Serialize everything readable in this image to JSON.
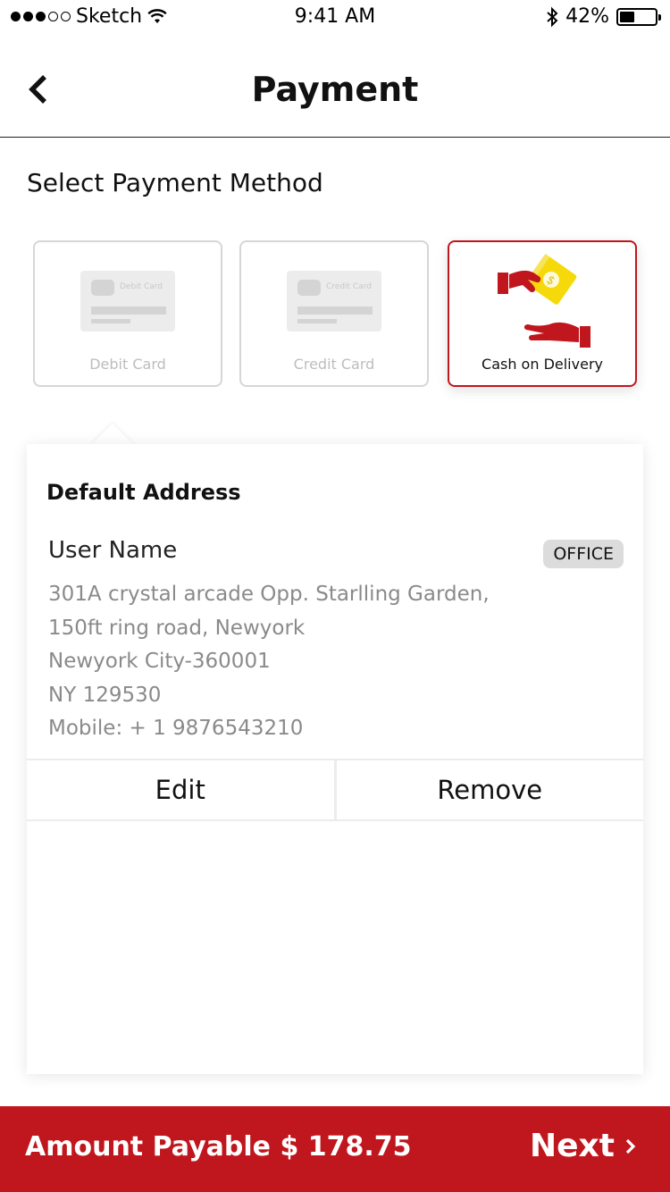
{
  "status_bar": {
    "carrier": "Sketch",
    "time": "9:41 AM",
    "battery": "42%",
    "battery_level": 0.42
  },
  "nav": {
    "title": "Payment"
  },
  "section_title": "Select Payment Method",
  "methods": [
    {
      "label": "Debit Card",
      "card_text": "Debit Card",
      "selected": false
    },
    {
      "label": "Credit Card",
      "card_text": "Credit Card",
      "selected": false
    },
    {
      "label": "Cash on Delivery",
      "selected": true
    }
  ],
  "address": {
    "heading": "Default Address",
    "user_name": "User Name",
    "tag": "OFFICE",
    "lines": [
      "301A crystal arcade Opp. Starlling Garden,",
      "150ft ring road, Newyork",
      "Newyork City-360001",
      "NY 129530",
      "Mobile: + 1 9876543210"
    ],
    "edit_label": "Edit",
    "remove_label": "Remove"
  },
  "footer": {
    "amount_label": "Amount Payable $ 178.75",
    "next_label": "Next"
  },
  "colors": {
    "accent": "#c0161d",
    "coin": "#f5d90a"
  },
  "icons": {
    "back": "chevron-left-icon",
    "next": "chevron-right-icon",
    "cod": "cash-hand-icon"
  }
}
